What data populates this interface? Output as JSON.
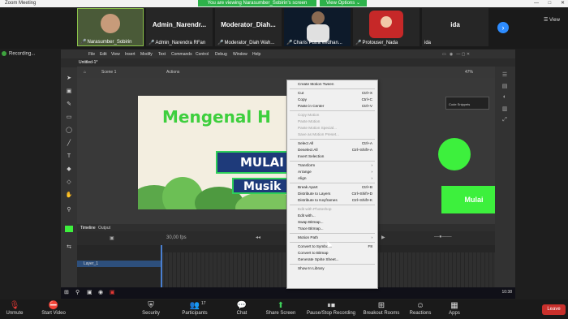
{
  "zoom": {
    "window_title": "Zoom Meeting",
    "share_banner": "You are viewing Narasumber_Sobirin's screen",
    "view_options": "View Options ⌄",
    "view_label": "View"
  },
  "participants": [
    {
      "name": "Narasumber_Sobirin",
      "muted": true,
      "big_label": ""
    },
    {
      "name": "Admin_Narendra RFan",
      "muted": true,
      "big_label": "Admin_Narendr..."
    },
    {
      "name": "Moderator_Diah Wah...",
      "muted": true,
      "big_label": "Moderator_Diah..."
    },
    {
      "name": "Charis Putra Widhan...",
      "muted": true,
      "big_label": ""
    },
    {
      "name": "Protouser_Nada",
      "muted": true,
      "big_label": ""
    },
    {
      "name": "ida",
      "muted": false,
      "big_label": "ida"
    }
  ],
  "recording_label": "Recording...",
  "animate": {
    "menus": [
      "File",
      "Edit",
      "View",
      "Insert",
      "Modify",
      "Text",
      "Commands",
      "Control",
      "Debug",
      "Window",
      "Help"
    ],
    "doc_tab": "Untitled-1*",
    "scene": "Scene 1",
    "actions_label": "Actions",
    "zoom_level": "47%",
    "snippets_label": "Code Snippets",
    "stage_title": "Mengenal H",
    "stage_btn1": "MULAI",
    "stage_btn2": "Musik",
    "green_button": "Mulai",
    "timeline_tab": "Timeline",
    "output_tab": "Output",
    "fps": "30,00 fps",
    "layer_name": "Layer_1"
  },
  "context_menu": [
    {
      "label": "Create Motion Tween",
      "shortcut": "",
      "enabled": true
    },
    {
      "sep": true
    },
    {
      "label": "Cut",
      "shortcut": "Ctrl+X",
      "enabled": true
    },
    {
      "label": "Copy",
      "shortcut": "Ctrl+C",
      "enabled": true
    },
    {
      "label": "Paste in Center",
      "shortcut": "Ctrl+V",
      "enabled": true
    },
    {
      "sep": true
    },
    {
      "label": "Copy Motion",
      "shortcut": "",
      "enabled": false
    },
    {
      "label": "Paste Motion",
      "shortcut": "",
      "enabled": false
    },
    {
      "label": "Paste Motion Special...",
      "shortcut": "",
      "enabled": false
    },
    {
      "label": "Save as Motion Preset...",
      "shortcut": "",
      "enabled": false
    },
    {
      "sep": true
    },
    {
      "label": "Select All",
      "shortcut": "Ctrl+A",
      "enabled": true
    },
    {
      "label": "Deselect All",
      "shortcut": "Ctrl+Shift+A",
      "enabled": true
    },
    {
      "label": "Invert Selection",
      "shortcut": "",
      "enabled": true
    },
    {
      "sep": true
    },
    {
      "label": "Transform",
      "shortcut": "›",
      "enabled": true
    },
    {
      "label": "Arrange",
      "shortcut": "›",
      "enabled": true
    },
    {
      "label": "Align",
      "shortcut": "›",
      "enabled": true
    },
    {
      "sep": true
    },
    {
      "label": "Break Apart",
      "shortcut": "Ctrl+B",
      "enabled": true
    },
    {
      "label": "Distribute to Layers",
      "shortcut": "Ctrl+Shift+D",
      "enabled": true
    },
    {
      "label": "Distribute to Keyframes",
      "shortcut": "Ctrl+Shift+K",
      "enabled": true
    },
    {
      "sep": true
    },
    {
      "label": "Edit with Photoshop",
      "shortcut": "",
      "enabled": false
    },
    {
      "label": "Edit with...",
      "shortcut": "",
      "enabled": true
    },
    {
      "label": "Swap Bitmap...",
      "shortcut": "",
      "enabled": true
    },
    {
      "label": "Trace Bitmap...",
      "shortcut": "",
      "enabled": true
    },
    {
      "sep": true
    },
    {
      "label": "Motion Path",
      "shortcut": "›",
      "enabled": true
    },
    {
      "sep": true
    },
    {
      "label": "Convert to Symbol...",
      "shortcut": "F8",
      "enabled": true
    },
    {
      "label": "Convert to Bitmap",
      "shortcut": "",
      "enabled": true
    },
    {
      "label": "Generate Sprite Sheet...",
      "shortcut": "",
      "enabled": true
    },
    {
      "sep": true
    },
    {
      "label": "Show In Library",
      "shortcut": "",
      "enabled": true
    }
  ],
  "taskbar": {
    "clock": "10:38"
  },
  "toolbar": {
    "unmute": "Unmute",
    "start_video": "Start Video",
    "security": "Security",
    "participants": "Participants",
    "participants_count": "17",
    "chat": "Chat",
    "share_screen": "Share Screen",
    "recording": "Pause/Stop Recording",
    "breakout": "Breakout Rooms",
    "reactions": "Reactions",
    "apps": "Apps",
    "leave": "Leave"
  }
}
